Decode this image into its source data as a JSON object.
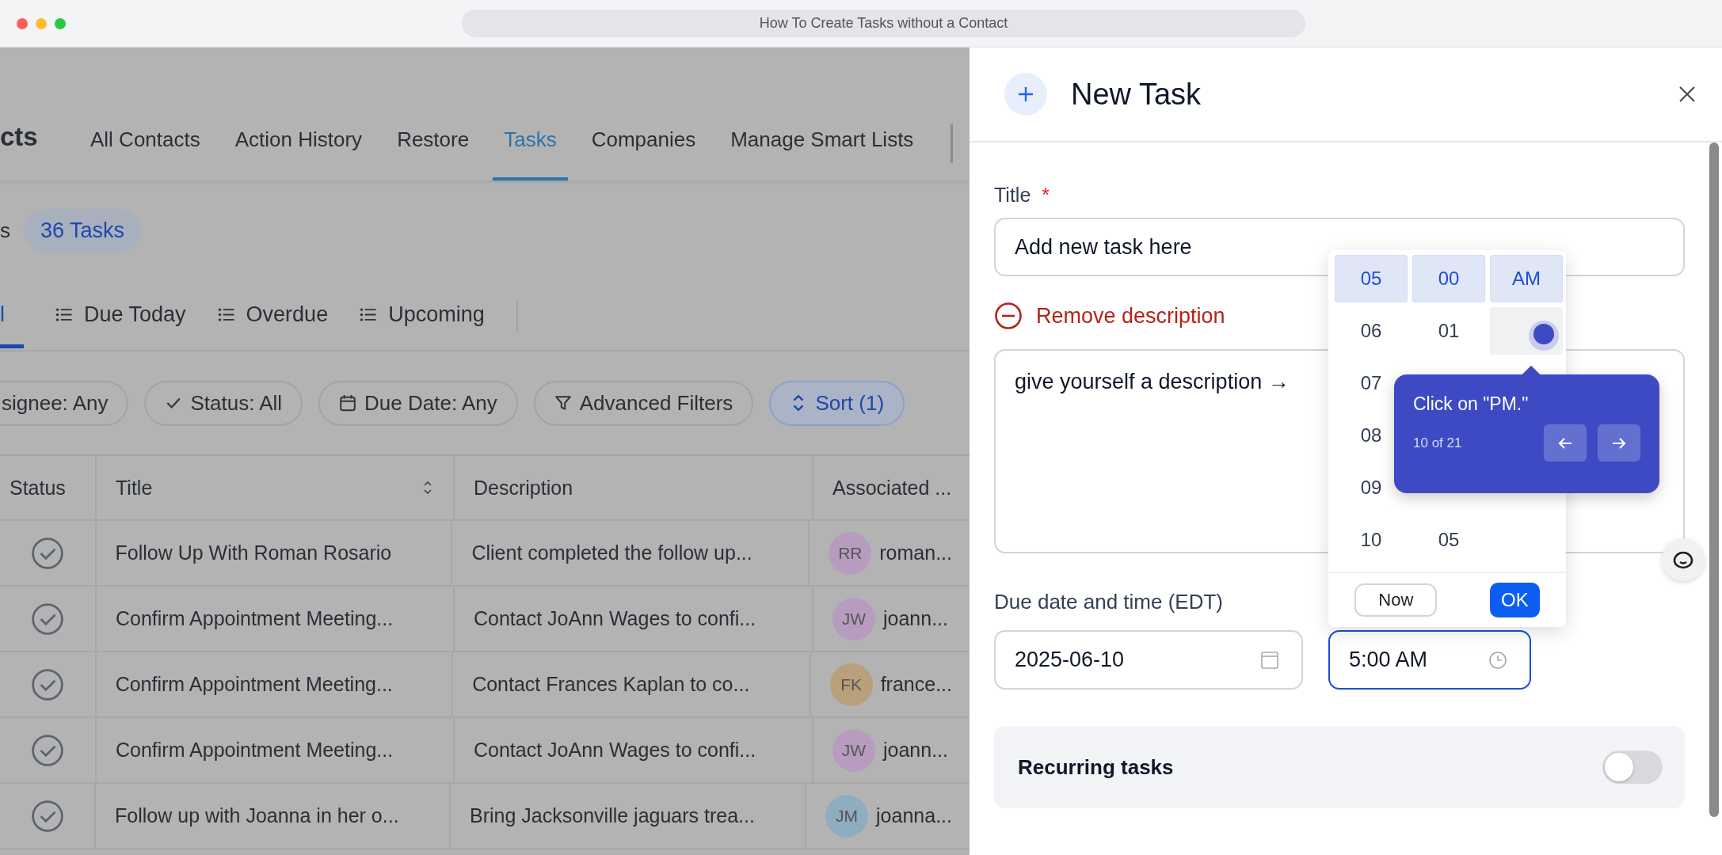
{
  "browser": {
    "title": "How To Create Tasks without a Contact"
  },
  "page": {
    "heading": "cts",
    "tabs": [
      {
        "label": "All Contacts",
        "selected": false
      },
      {
        "label": "Action History",
        "selected": false
      },
      {
        "label": "Restore",
        "selected": false
      },
      {
        "label": "Tasks",
        "selected": true
      },
      {
        "label": "Companies",
        "selected": false
      },
      {
        "label": "Manage Smart Lists",
        "selected": false
      }
    ],
    "count_prefix": "s",
    "count": "36 Tasks",
    "views": [
      {
        "label": "l",
        "selected": true
      },
      {
        "label": "Due Today",
        "selected": false
      },
      {
        "label": "Overdue",
        "selected": false
      },
      {
        "label": "Upcoming",
        "selected": false
      }
    ],
    "filters": [
      {
        "label": "signee: Any",
        "kind": "plain"
      },
      {
        "label": "Status: All",
        "kind": "check"
      },
      {
        "label": "Due Date: Any",
        "kind": "date"
      },
      {
        "label": "Advanced Filters",
        "kind": "filter"
      },
      {
        "label": "Sort (1)",
        "kind": "sort"
      }
    ]
  },
  "table": {
    "columns": [
      "Status",
      "Title",
      "Description",
      "Associated ..."
    ],
    "rows": [
      {
        "title": "Follow Up With Roman Rosario",
        "description": "Client completed the follow up...",
        "initials": "RR",
        "contact": "roman...",
        "color": "#b89cc0"
      },
      {
        "title": "Confirm Appointment Meeting...",
        "description": "Contact JoAnn Wages to confi...",
        "initials": "JW",
        "contact": "joann...",
        "color": "#b89cc0"
      },
      {
        "title": "Confirm Appointment Meeting...",
        "description": "Contact Frances Kaplan to co...",
        "initials": "FK",
        "contact": "france...",
        "color": "#b9a07a"
      },
      {
        "title": "Confirm Appointment Meeting...",
        "description": "Contact JoAnn Wages to confi...",
        "initials": "JW",
        "contact": "joann...",
        "color": "#b89cc0"
      },
      {
        "title": "Follow up with Joanna in her o...",
        "description": "Bring Jacksonville jaguars trea...",
        "initials": "JM",
        "contact": "joanna...",
        "color": "#8eaec0"
      }
    ]
  },
  "panel": {
    "title": "New Task",
    "title_label": "Title",
    "required": "*",
    "title_value": "Add new task here",
    "remove_description": "Remove description",
    "description": "give yourself a description →",
    "due_label": "Due date and time (EDT)",
    "date": "2025-06-10",
    "time": "5:00 AM",
    "recurring": {
      "label": "Recurring tasks",
      "on": false
    }
  },
  "time_picker": {
    "hours": [
      {
        "label": "05",
        "selected": true
      },
      {
        "label": "06",
        "selected": false
      },
      {
        "label": "07",
        "selected": false
      },
      {
        "label": "08",
        "selected": false
      },
      {
        "label": "09",
        "selected": false
      },
      {
        "label": "10",
        "selected": false
      }
    ],
    "minutes": [
      {
        "label": "00",
        "selected": true
      },
      {
        "label": "01",
        "selected": false
      },
      {
        "label": "05",
        "selected": false
      }
    ],
    "periods": [
      {
        "label": "AM",
        "selected": true,
        "hovered": false
      },
      {
        "selected": false,
        "hovered": true
      }
    ],
    "now": "Now",
    "ok": "OK"
  },
  "tooltip": {
    "text": "Click on \"PM.\"",
    "step": "10 of 21"
  }
}
